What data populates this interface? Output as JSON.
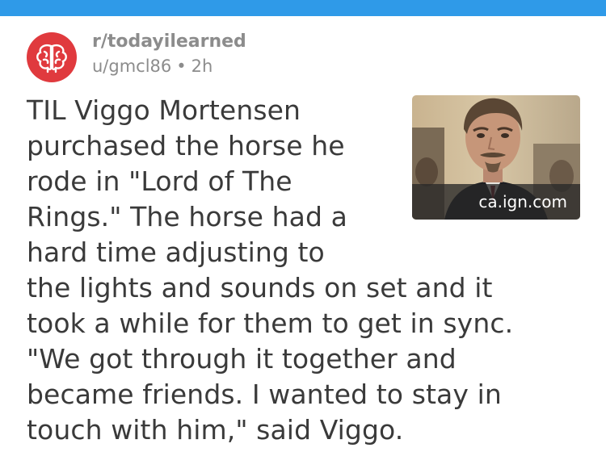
{
  "colors": {
    "topbar": "#2f9ae8",
    "avatar_bg": "#e03a3e",
    "meta_text": "#8c8c8c",
    "title_text": "#3a3a3a"
  },
  "post": {
    "subreddit": "r/todayilearned",
    "author": "u/gmcl86",
    "separator": "•",
    "age": "2h",
    "avatar_icon": "brain-icon",
    "title_lines": [
      "TIL Viggo Mortensen",
      "purchased the horse he",
      "rode in \"Lord of The",
      "Rings.\" The horse had a",
      "hard time adjusting to",
      "the lights and sounds on set and it",
      "took a while for them to get in sync.",
      "\"We got through it together and",
      "became friends. I wanted to stay in",
      "touch with him,\" said Viggo."
    ],
    "thumbnail": {
      "domain": "ca.ign.com"
    }
  }
}
